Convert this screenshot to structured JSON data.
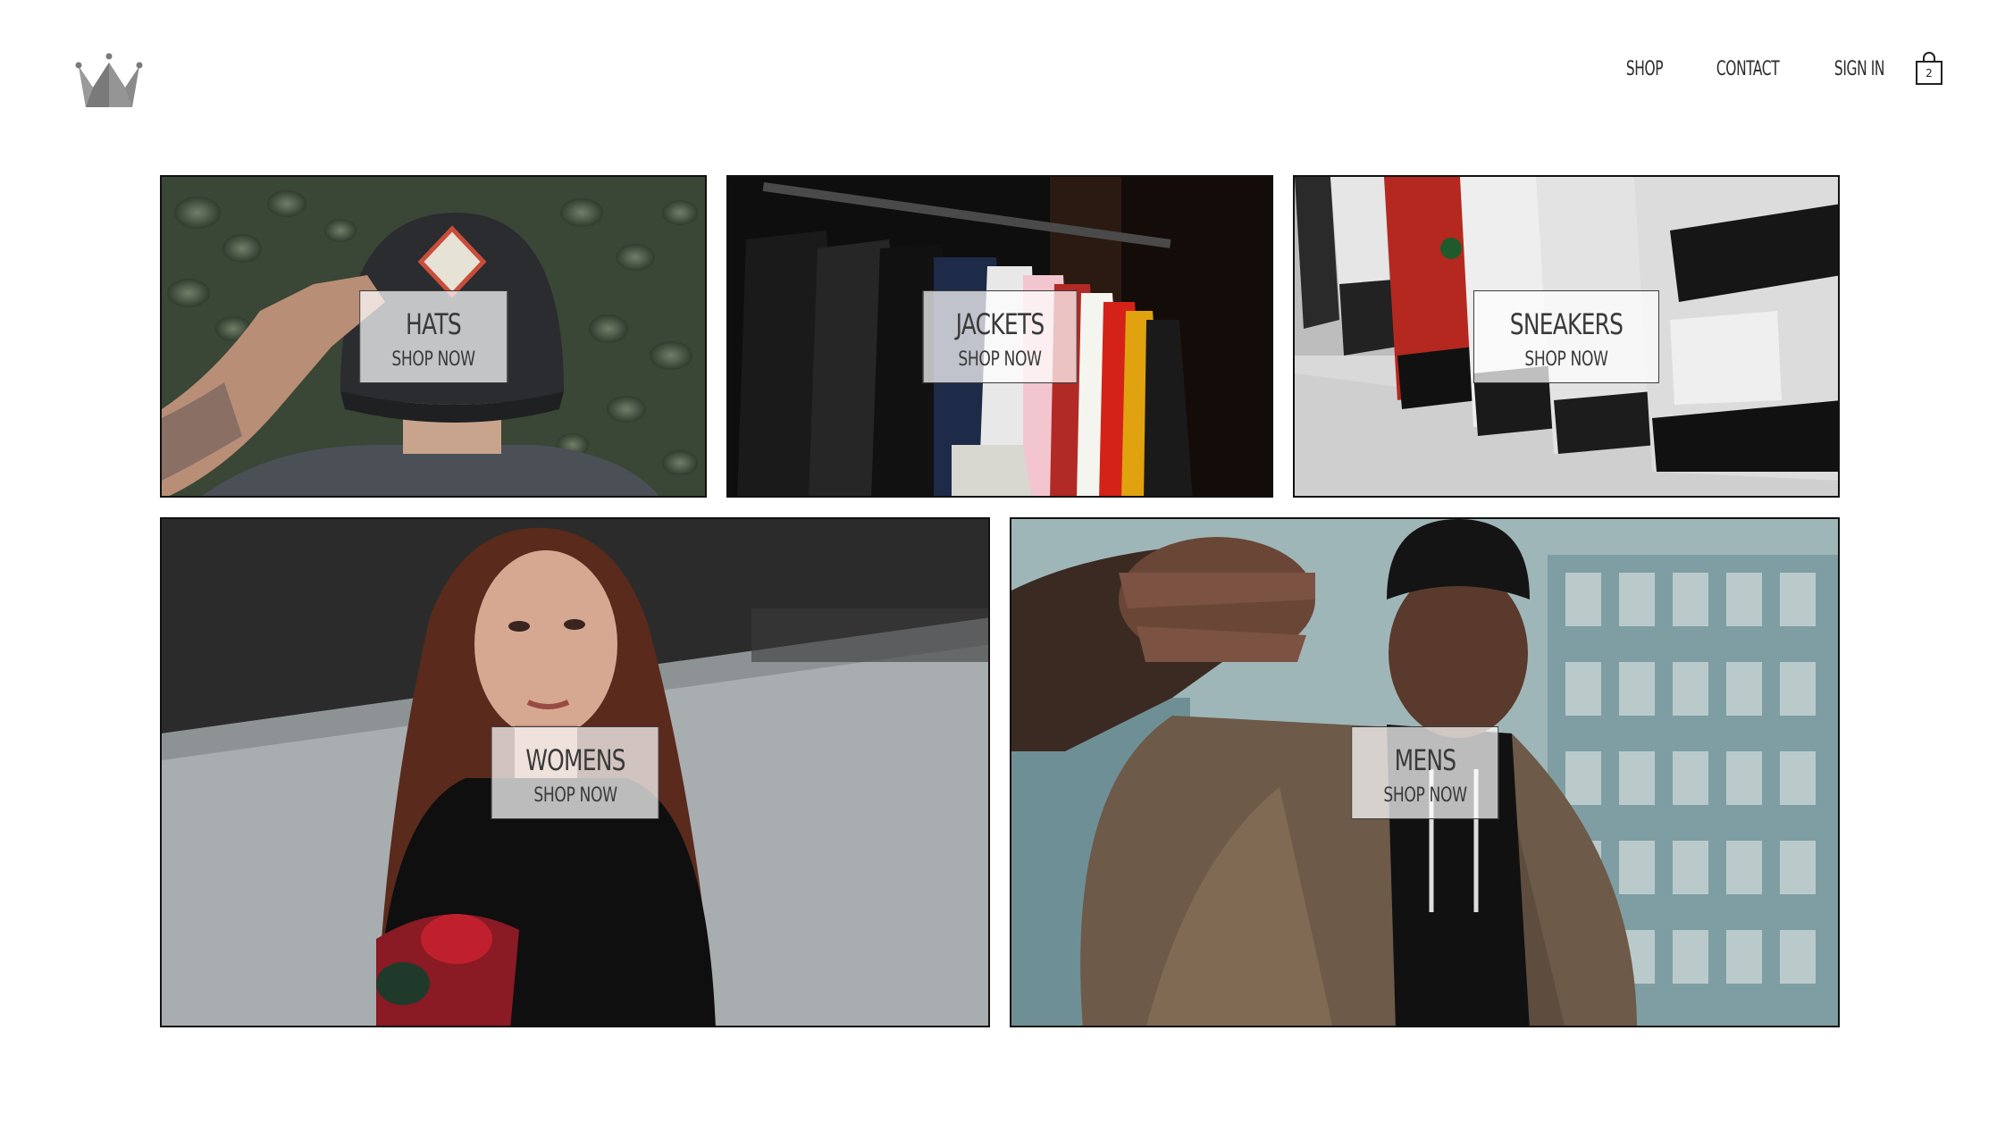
{
  "header": {
    "logo_icon": "crown-icon",
    "nav": [
      {
        "label": "SHOP"
      },
      {
        "label": "CONTACT"
      },
      {
        "label": "SIGN IN"
      }
    ],
    "cart": {
      "icon": "shopping-bag-icon",
      "count": "2"
    }
  },
  "directory": {
    "tiles": [
      {
        "title": "HATS",
        "cta": "SHOP NOW"
      },
      {
        "title": "JACKETS",
        "cta": "SHOP NOW"
      },
      {
        "title": "SNEAKERS",
        "cta": "SHOP NOW"
      },
      {
        "title": "WOMENS",
        "cta": "SHOP NOW"
      },
      {
        "title": "MENS",
        "cta": "SHOP NOW"
      }
    ]
  },
  "colors": {
    "background": "#ffffff",
    "text": "#333333",
    "logo": "#808080",
    "tile_border": "#111111"
  }
}
